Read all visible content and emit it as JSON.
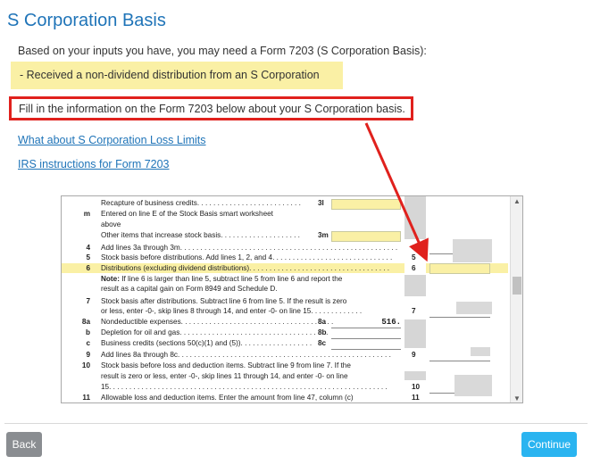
{
  "page_title": "S Corporation Basis",
  "intro_text": "Based on your inputs you have, you may need a Form 7203 (S Corporation Basis):",
  "callout_text": "- Received a non-dividend distribution from an S Corporation",
  "fill_in_text": "Fill in the information on the Form 7203 below about your S Corporation basis.",
  "links": {
    "loss_limits": "What about S Corporation Loss Limits",
    "instructions": "IRS instructions for Form 7203"
  },
  "form": {
    "rows": [
      {
        "ln": "",
        "text": "Recapture of business credits. . . . . . . . . . . . . . . . . . . . . . . . . .",
        "sub": "3l"
      },
      {
        "ln": "m",
        "text": "Entered on line E of the Stock Basis smart worksheet"
      },
      {
        "ln": "",
        "text": "above"
      },
      {
        "ln": "",
        "text": "Other items that increase stock basis. . . . . . . . . . . . . . . . . . . .",
        "sub": "3m"
      },
      {
        "ln": "4",
        "text": "Add lines 3a through 3m. . . . . . . . . . . . . . . . . . . . . . . . . . . . . . . . . . . . . . . . . . . . . . . . . . . . . .",
        "rn": "4"
      },
      {
        "ln": "5",
        "text": "Stock basis before distributions. Add lines 1, 2, and 4. . . . . . . . . . . . . . . . . . . . . . . . . . . . . .",
        "rn": "5"
      },
      {
        "ln": "6",
        "text": "Distributions (excluding dividend distributions). . . . . . . . . . . . . . . . . . . . . . . . . . . . . . . . . . .",
        "rn": "6"
      },
      {
        "ln": "",
        "bold": "Note:",
        "text": " If line 6 is larger than line 5, subtract line 5 from line 6 and report the"
      },
      {
        "ln": "",
        "text": "result as a capital gain on Form 8949 and Schedule D."
      },
      {
        "ln": "7",
        "text": "Stock basis after distributions. Subtract line 6 from line 5. If the result is zero"
      },
      {
        "ln": "",
        "text": "or less, enter -0-, skip lines 8 through 14, and enter -0- on line 15. . . . . . . . . . . . .",
        "rn": "7"
      },
      {
        "ln": "8a",
        "text": "Nondeductible expenses. . . . . . . . . . . . . . . . . . . . . . . . . . . . . . . . . . . . . .",
        "sub": "8a",
        "value": "516."
      },
      {
        "ln": "b",
        "text": "Depletion for oil and gas. . . . . . . . . . . . . . . . . . . . . . . . . . . . . . . . . . . . .",
        "sub": "8b"
      },
      {
        "ln": "c",
        "text": "Business credits (sections 50(c)(1) and (5)). . . . . . . . . . . . . . . . . .",
        "sub": "8c"
      },
      {
        "ln": "9",
        "text": "Add lines 8a through 8c. . . . . . . . . . . . . . . . . . . . . . . . . . . . . . . . . . . . . . . . . . . . . . . . . . . . .",
        "rn": "9"
      },
      {
        "ln": "10",
        "text": "Stock basis before loss and deduction items. Subtract line 9 from line 7. If the"
      },
      {
        "ln": "",
        "text": "result is zero or less, enter -0-, skip lines 11 through 14, and enter -0- on line"
      },
      {
        "ln": "",
        "text": "15. . . . . . . . . . . . . . . . . . . . . . . . . . . . . . . . . . . . . . . . . . . . . . . . . . . . . . . . . . . . . . . . . . . . .",
        "rn": "10"
      },
      {
        "ln": "11",
        "text": "Allowable loss and deduction items. Enter the amount from line 47, column (c)",
        "rn": "11"
      }
    ]
  },
  "buttons": {
    "back": "Back",
    "continue": "Continue"
  },
  "colors": {
    "title_blue": "#1f74b8",
    "callout_yellow": "#faf0a5",
    "highlight_red": "#e0211d",
    "continue_blue": "#2ab4f0",
    "back_gray": "#8a8d91"
  }
}
